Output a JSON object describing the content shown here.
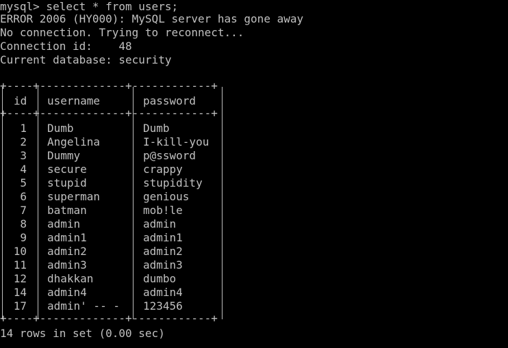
{
  "terminal": {
    "lines": {
      "command": "mysql> select * from users;",
      "error": "ERROR 2006 (HY000): MySQL server has gone away",
      "reconnect": "No connection. Trying to reconnect...",
      "connection_id": "Connection id:    48",
      "current_db": "Current database: security"
    },
    "table": {
      "border": "+----+-------------+------------+",
      "headers": [
        "id",
        "username",
        "password"
      ],
      "rows": [
        {
          "id": "1",
          "username": "Dumb",
          "password": "Dumb"
        },
        {
          "id": "2",
          "username": "Angelina",
          "password": "I-kill-you"
        },
        {
          "id": "3",
          "username": "Dummy",
          "password": "p@ssword"
        },
        {
          "id": "4",
          "username": "secure",
          "password": "crappy"
        },
        {
          "id": "5",
          "username": "stupid",
          "password": "stupidity"
        },
        {
          "id": "6",
          "username": "superman",
          "password": "genious"
        },
        {
          "id": "7",
          "username": "batman",
          "password": "mob!le"
        },
        {
          "id": "8",
          "username": "admin",
          "password": "admin"
        },
        {
          "id": "9",
          "username": "admin1",
          "password": "admin1"
        },
        {
          "id": "10",
          "username": "admin2",
          "password": "admin2"
        },
        {
          "id": "11",
          "username": "admin3",
          "password": "admin3"
        },
        {
          "id": "12",
          "username": "dhakkan",
          "password": "dumbo"
        },
        {
          "id": "14",
          "username": "admin4",
          "password": "admin4"
        },
        {
          "id": "17",
          "username": "admin' -- -",
          "password": "123456"
        }
      ]
    },
    "footer": "14 rows in set (0.00 sec)"
  }
}
